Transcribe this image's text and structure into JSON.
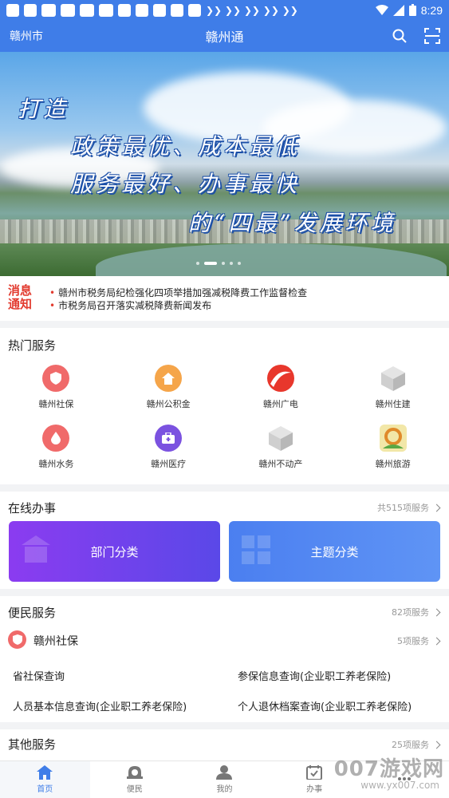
{
  "status_bar": {
    "time": "8:29"
  },
  "header": {
    "city": "赣州市",
    "title": "赣州通"
  },
  "banner": {
    "slogan_lines": [
      "打造",
      "政策最优、成本最低",
      "服务最好、办事最快",
      "的“四最”发展环境"
    ],
    "slide_count": 5,
    "active_slide": 2
  },
  "news": {
    "logo_line1": "消息",
    "logo_line2": "通知",
    "items": [
      "赣州市税务局纪检强化四项举措加强减税降费工作监督检查",
      "市税务局召开落实减税降费新闻发布"
    ]
  },
  "hot_services": {
    "title": "热门服务",
    "items": [
      {
        "label": "赣州社保",
        "icon": "shield-icon",
        "color": "#f06a6a"
      },
      {
        "label": "赣州公积金",
        "icon": "house-icon",
        "color": "#f5a54a"
      },
      {
        "label": "赣州广电",
        "icon": "broadcast-logo-icon",
        "color": "#e8372c"
      },
      {
        "label": "赣州住建",
        "icon": "cube-icon",
        "color": "#c9c9c9"
      },
      {
        "label": "赣州水务",
        "icon": "water-drop-icon",
        "color": "#f06a6a"
      },
      {
        "label": "赣州医疗",
        "icon": "medical-kit-icon",
        "color": "#7b52e0"
      },
      {
        "label": "赣州不动产",
        "icon": "cube-icon",
        "color": "#c9c9c9"
      },
      {
        "label": "赣州旅游",
        "icon": "travel-logo-icon",
        "color": "#e6b83a"
      }
    ]
  },
  "online": {
    "title": "在线办事",
    "count_text": "共515项服务",
    "buttons": [
      {
        "label": "部门分类",
        "color_from": "#8b3cf0",
        "color_to": "#5a48e8"
      },
      {
        "label": "主题分类",
        "color_from": "#4b7ff0",
        "color_to": "#5f94f5"
      }
    ]
  },
  "convenience": {
    "title": "便民服务",
    "count_text": "82项服务",
    "sub_title": "赣州社保",
    "sub_count": "5项服务",
    "items": [
      "省社保查询",
      "参保信息查询(企业职工养老保险)",
      "人员基本信息查询(企业职工养老保险)",
      "个人退休档案查询(企业职工养老保险)"
    ]
  },
  "other": {
    "title": "其他服务",
    "count_text": "25项服务"
  },
  "tabbar": {
    "tabs": [
      {
        "label": "首页",
        "icon": "home-icon",
        "active": true
      },
      {
        "label": "便民",
        "icon": "service-person-icon",
        "active": false
      },
      {
        "label": "我的",
        "icon": "user-icon",
        "active": false
      },
      {
        "label": "办事",
        "icon": "calendar-check-icon",
        "active": false
      },
      {
        "label": "",
        "icon": "more-icon",
        "active": false
      }
    ]
  },
  "watermark": {
    "line1": "007游戏网",
    "line2": "www.yx007.com"
  }
}
